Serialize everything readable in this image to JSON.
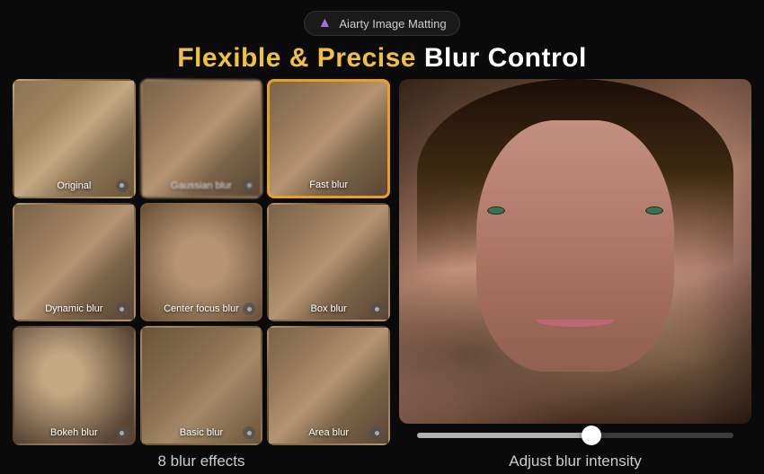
{
  "header": {
    "badge_text": "Aiarty Image Matting",
    "title_part1": "Flexible & Precise",
    "title_part2": " Blur Control"
  },
  "grid": {
    "items": [
      {
        "id": "original",
        "label": "Original",
        "selected": false,
        "class": "thumb-original"
      },
      {
        "id": "gaussian",
        "label": "Gaussian blur",
        "selected": false,
        "class": "thumb-gaussian"
      },
      {
        "id": "fast",
        "label": "Fast blur",
        "selected": true,
        "class": "thumb-fast"
      },
      {
        "id": "dynamic",
        "label": "Dynamic blur",
        "selected": false,
        "class": "thumb-dynamic"
      },
      {
        "id": "center_focus",
        "label": "Center focus blur",
        "selected": false,
        "class": "thumb-center"
      },
      {
        "id": "box",
        "label": "Box blur",
        "selected": false,
        "class": "thumb-box"
      },
      {
        "id": "bokeh",
        "label": "Bokeh blur",
        "selected": false,
        "class": "thumb-bokeh"
      },
      {
        "id": "basic",
        "label": "Basic blur",
        "selected": false,
        "class": "thumb-basic"
      },
      {
        "id": "area",
        "label": "Area blur",
        "selected": false,
        "class": "thumb-area"
      }
    ],
    "bottom_label": "8 blur effects"
  },
  "preview": {
    "bottom_label": "Adjust blur intensity",
    "slider_position_pct": 55
  },
  "logo_icon": "▲"
}
